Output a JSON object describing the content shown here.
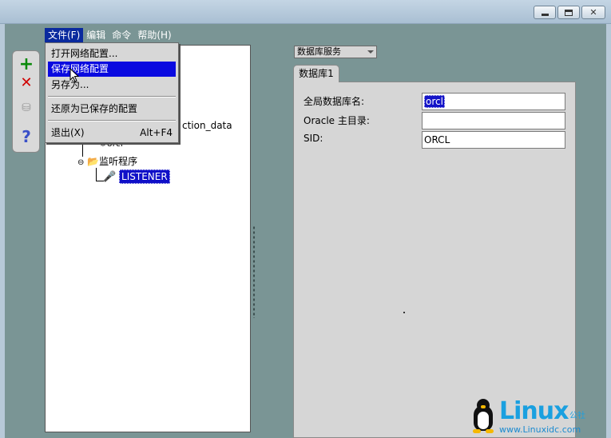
{
  "menubar": [
    {
      "label": "文件(F)",
      "active": true
    },
    {
      "label": "编辑",
      "active": false
    },
    {
      "label": "命令",
      "active": false
    },
    {
      "label": "帮助(H)",
      "active": false
    }
  ],
  "file_menu": {
    "items": [
      {
        "label": "打开网络配置...",
        "accel": ""
      },
      {
        "label": "保存网络配置",
        "accel": ""
      },
      {
        "label": "另存为...",
        "accel": ""
      },
      {
        "label": "还原为已保存的配置",
        "accel": ""
      },
      {
        "label": "退出(X)",
        "accel": "Alt+F4"
      }
    ]
  },
  "tree": {
    "partial_node": "ction_data",
    "db_node": "orcl",
    "listeners_folder": "监听程序",
    "listener": "LISTENER"
  },
  "right_panel": {
    "combo_value": "数据库服务",
    "tab_label": "数据库1",
    "fields": [
      {
        "label": "全局数据库名:",
        "value": "orcl",
        "selected": true
      },
      {
        "label": "Oracle 主目录:",
        "value": "",
        "selected": false
      },
      {
        "label": "SID:",
        "value": "ORCL",
        "selected": false
      }
    ]
  },
  "watermark": {
    "title": "Linux",
    "subtitle": "公社",
    "url": "www.Linuxidc.com"
  },
  "icons": {
    "add": "plus-icon",
    "delete": "x-icon",
    "database": "database-icon",
    "help": "question-icon"
  },
  "colors": {
    "menu_highlight": "#0a0ae0",
    "frame_bg": "#7a9595",
    "watermark_blue": "#1aa0e0"
  }
}
